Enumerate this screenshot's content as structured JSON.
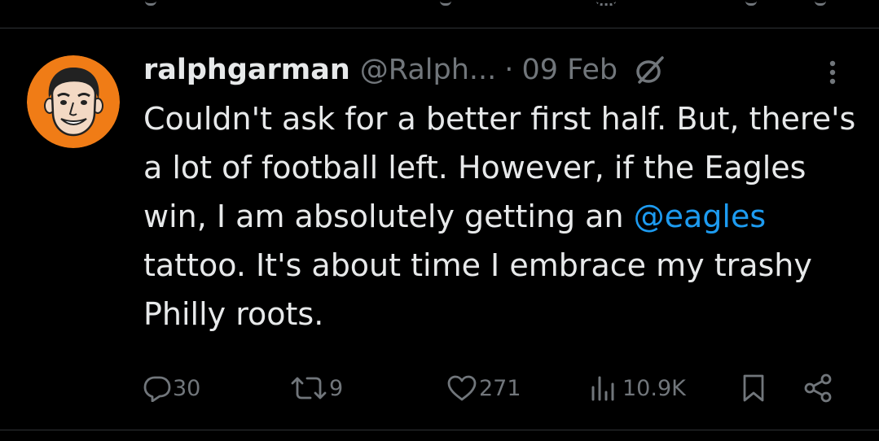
{
  "tweet": {
    "display_name": "ralphgarman",
    "handle": "@Ralph...",
    "separator": "·",
    "date": "09 Feb",
    "text_part1": "Couldn't ask for a better first half. But, there's a lot of football left. However, if the Eagles win, I am absolutely getting an ",
    "mention": "@eagles",
    "text_part2": " tattoo. It's about time I embrace my trashy Philly roots."
  },
  "stats": {
    "replies": "30",
    "reposts": "9",
    "likes": "271",
    "views": "10.9K"
  },
  "icons": {
    "avatar": "cartoon-avatar",
    "grok": "grok-icon",
    "more": "more-vertical-icon",
    "reply": "reply-icon",
    "repost": "repost-icon",
    "like": "heart-icon",
    "views": "views-icon",
    "bookmark": "bookmark-icon",
    "share": "share-icon"
  },
  "colors": {
    "background": "#000000",
    "text": "#e7e9ea",
    "muted": "#71767b",
    "link": "#1d9bf0",
    "avatar_bg": "#f07c16",
    "divider": "#2f3336"
  }
}
